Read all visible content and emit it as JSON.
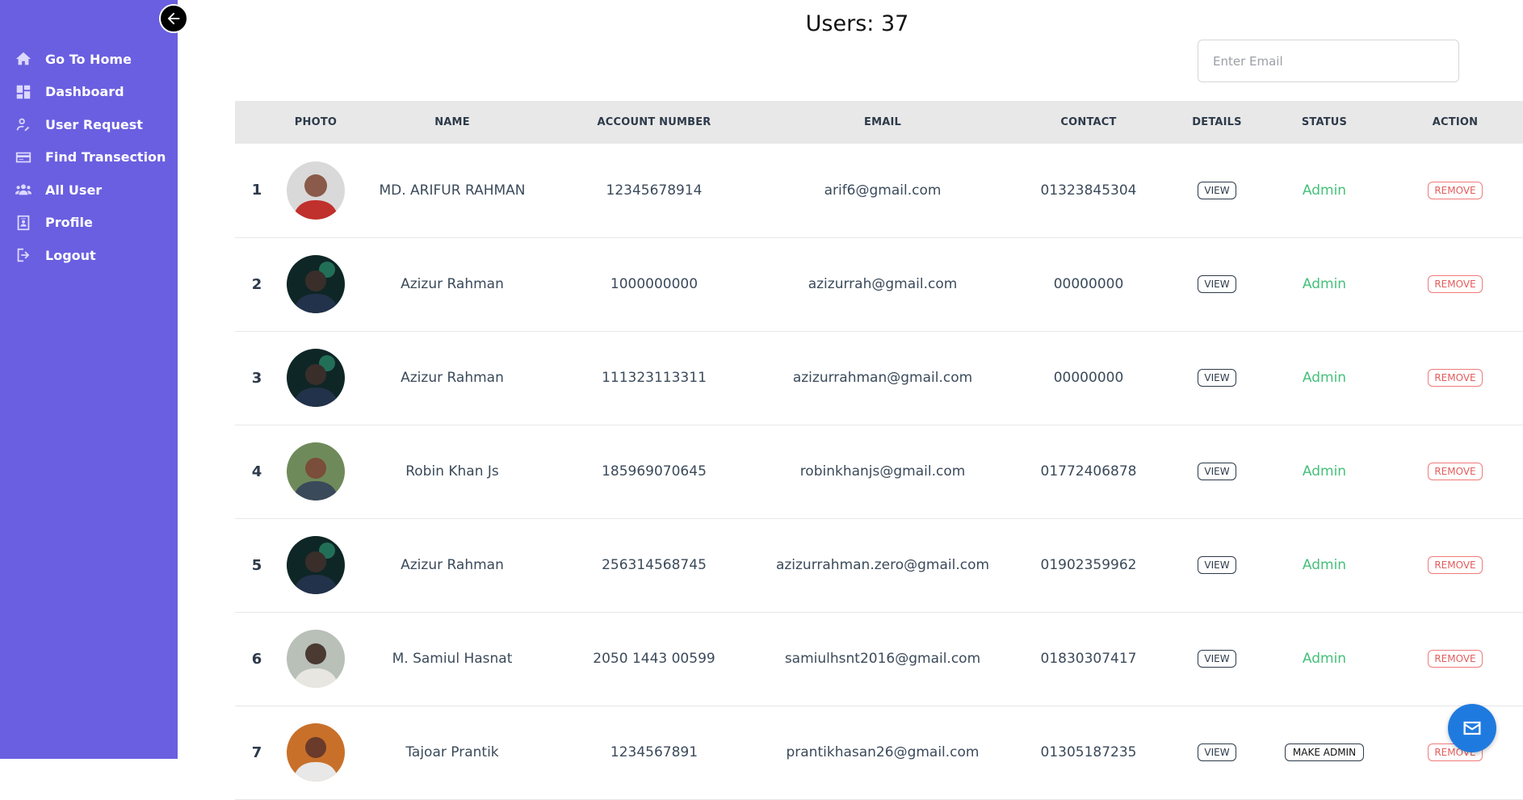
{
  "sidebar": {
    "items": [
      {
        "label": "Go To Home",
        "icon": "home-icon"
      },
      {
        "label": "Dashboard",
        "icon": "dashboard-icon"
      },
      {
        "label": "User Request",
        "icon": "user-request-icon"
      },
      {
        "label": "Find Transection",
        "icon": "card-icon"
      },
      {
        "label": "All User",
        "icon": "users-icon"
      },
      {
        "label": "Profile",
        "icon": "profile-icon"
      },
      {
        "label": "Logout",
        "icon": "logout-icon"
      }
    ]
  },
  "header": {
    "title": "Users: 37"
  },
  "search": {
    "placeholder": "Enter Email",
    "value": ""
  },
  "table": {
    "columns": [
      "",
      "PHOTO",
      "NAME",
      "ACCOUNT NUMBER",
      "EMAIL",
      "CONTACT",
      "DETAILS",
      "STATUS",
      "ACTION"
    ],
    "view_label": "VIEW",
    "remove_label": "REMOVE",
    "rows": [
      {
        "index": "1",
        "name": "MD. ARIFUR RAHMAN",
        "account": "12345678914",
        "email": "arif6@gmail.com",
        "contact": "01323845304",
        "status": "Admin",
        "avatar_color": "#8a5a4a"
      },
      {
        "index": "2",
        "name": "Azizur Rahman",
        "account": "1000000000",
        "email": "azizurrah@gmail.com",
        "contact": "00000000",
        "status": "Admin",
        "avatar_color": "#1c3a3a"
      },
      {
        "index": "3",
        "name": "Azizur Rahman",
        "account": "111323113311",
        "email": "azizurrahman@gmail.com",
        "contact": "00000000",
        "status": "Admin",
        "avatar_color": "#1c3a3a"
      },
      {
        "index": "4",
        "name": "Robin Khan Js",
        "account": "185969070645",
        "email": "robinkhanjs@gmail.com",
        "contact": "01772406878",
        "status": "Admin",
        "avatar_color": "#6b7a4a"
      },
      {
        "index": "5",
        "name": "Azizur Rahman",
        "account": "256314568745",
        "email": "azizurrahman.zero@gmail.com",
        "contact": "01902359962",
        "status": "Admin",
        "avatar_color": "#1c3a3a"
      },
      {
        "index": "6",
        "name": "M. Samiul Hasnat",
        "account": "2050 1443 00599",
        "email": "samiulhsnt2016@gmail.com",
        "contact": "01830307417",
        "status": "Admin",
        "avatar_color": "#7a8a7a"
      },
      {
        "index": "7",
        "name": "Tajoar Prantik",
        "account": "1234567891",
        "email": "prantikhasan26@gmail.com",
        "contact": "01305187235",
        "status": "MAKE ADMIN",
        "avatar_color": "#c04a3a"
      }
    ]
  },
  "colors": {
    "sidebar_bg": "#6a5fe0",
    "admin_status": "#46c07a",
    "remove": "#e35c5c",
    "fab": "#1f7ae0"
  }
}
